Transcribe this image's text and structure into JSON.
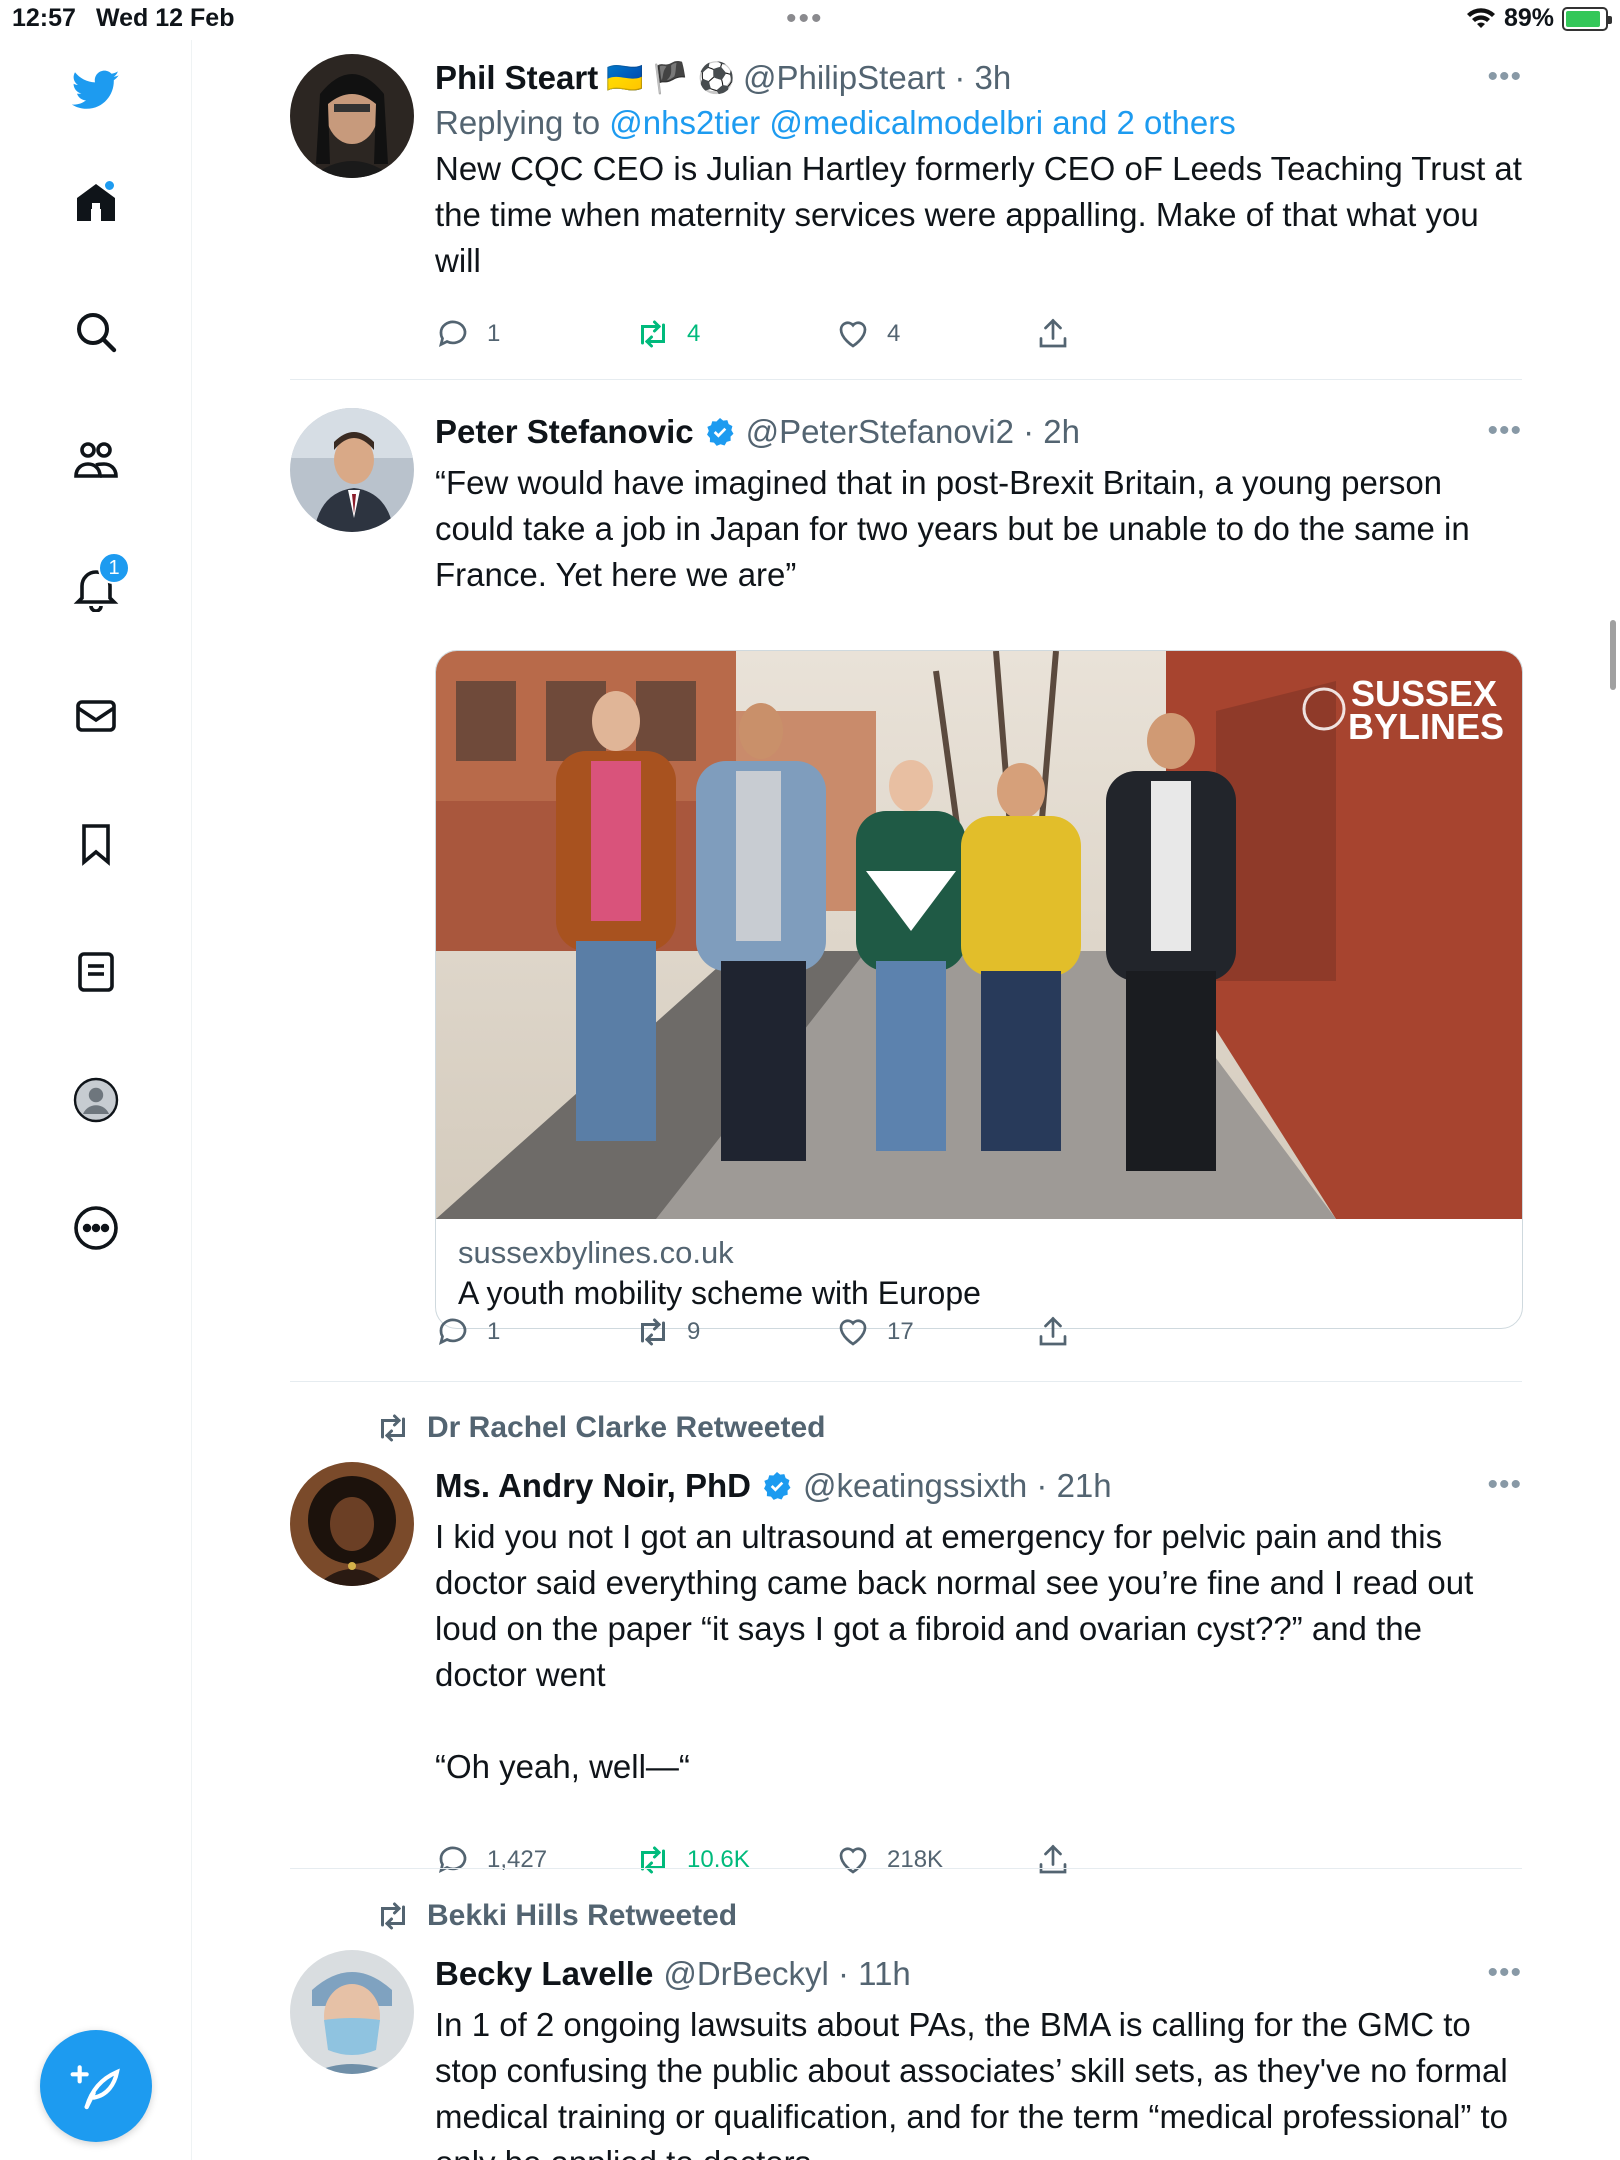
{
  "status_bar": {
    "time": "12:57",
    "date": "Wed 12 Feb",
    "battery": "89%",
    "battery_level": 0.89
  },
  "sidebar": {
    "items": [
      {
        "icon": "twitter-bird-icon"
      },
      {
        "icon": "home-icon"
      },
      {
        "icon": "search-icon"
      },
      {
        "icon": "communities-icon"
      },
      {
        "icon": "notifications-bell-icon",
        "badge": "1"
      },
      {
        "icon": "messages-icon"
      },
      {
        "icon": "bookmark-icon"
      },
      {
        "icon": "lists-icon"
      },
      {
        "icon": "profile-avatar-icon"
      },
      {
        "icon": "more-circle-icon"
      }
    ],
    "compose_icon": "compose-feather-icon"
  },
  "colors": {
    "accent": "#1d9bf0",
    "retweet_green": "#00ba7c",
    "secondary_text": "#536471"
  },
  "tweets": [
    {
      "name": "Phil Steart",
      "emojis": "🇺🇦 🏴 ⚽",
      "handle": "@PhilipSteart",
      "time": "3h",
      "reply_prefix": "Replying to ",
      "reply_links": "@nhs2tier @medicalmodelbri and 2 others",
      "text": "New CQC CEO is Julian Hartley formerly CEO oF Leeds Teaching Trust at the time when maternity services were appalling. Make of that what you will",
      "replies": "1",
      "retweets": "4",
      "likes": "4"
    },
    {
      "name": "Peter Stefanovic",
      "handle": "@PeterStefanovi2",
      "time": "2h",
      "text": "“Few would have imagined that in post-Brexit Britain, a young person could take a job in Japan for two years but be unable to do the same in France. Yet here we are”",
      "card": {
        "image_watermark_line1": "SUSSEX",
        "image_watermark_line2": "BYLINES",
        "domain": "sussexbylines.co.uk",
        "title": "A youth mobility scheme with Europe"
      },
      "replies": "1",
      "retweets": "9",
      "likes": "17"
    },
    {
      "retweeted_by": "Dr Rachel Clarke Retweeted",
      "name": "Ms. Andry Noir, PhD",
      "handle": "@keatingssixth",
      "time": "21h",
      "text": "I kid you not I got an ultrasound at emergency for pelvic pain and this doctor said everything came back normal see you’re fine and I read out loud on the paper “it says I got a fibroid and ovarian cyst??” and the doctor went\n\n“Oh yeah, well—“",
      "replies": "1,427",
      "retweets": "10.6K",
      "likes": "218K"
    },
    {
      "retweeted_by": "Bekki Hills Retweeted",
      "name": "Becky Lavelle",
      "handle": "@DrBeckyl",
      "time": "11h",
      "text": "In 1 of 2 ongoing lawsuits about PAs, the BMA is calling for the GMC to stop confusing the public about associates’ skill sets, as they've no formal medical training or qualification, and for the term “medical professional” to only be applied to doctors."
    }
  ]
}
